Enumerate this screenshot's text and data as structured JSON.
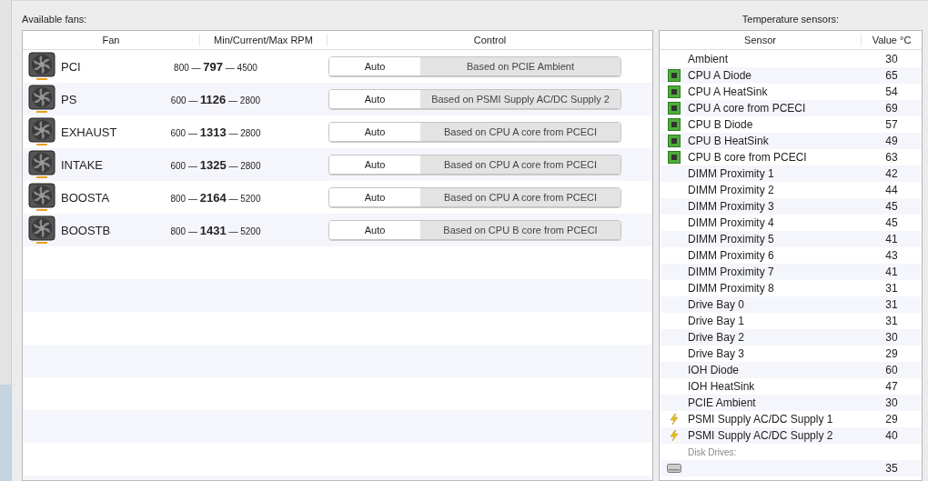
{
  "fans_panel": {
    "title": "Available fans:",
    "columns": [
      "Fan",
      "Min/Current/Max RPM",
      "Control"
    ],
    "rows": [
      {
        "name": "PCI",
        "rpm": "800 — **797** — 4500",
        "mode": "Auto",
        "based_on": "Based on PCIE Ambient"
      },
      {
        "name": "PS",
        "rpm": "600 — **1126** — 2800",
        "mode": "Auto",
        "based_on": "Based on PSMI Supply AC/DC Supply 2"
      },
      {
        "name": "EXHAUST",
        "rpm": "600 — **1313** — 2800",
        "mode": "Auto",
        "based_on": "Based on CPU A core from PCECI"
      },
      {
        "name": "INTAKE",
        "rpm": "600 — **1325** — 2800",
        "mode": "Auto",
        "based_on": "Based on CPU A core from PCECI"
      },
      {
        "name": "BOOSTA",
        "rpm": "800 — **2164** — 5200",
        "mode": "Auto",
        "based_on": "Based on CPU A core from PCECI"
      },
      {
        "name": "BOOSTB",
        "rpm": "800 — **1431** — 5200",
        "mode": "Auto",
        "based_on": "Based on CPU B core from PCECI"
      }
    ]
  },
  "sensors_panel": {
    "title": "Temperature sensors:",
    "columns": [
      "Sensor",
      "Value °C"
    ],
    "rows": [
      {
        "kind": "plain",
        "name": "Ambient",
        "value": "30"
      },
      {
        "kind": "chip",
        "name": "CPU A Diode",
        "value": "65"
      },
      {
        "kind": "chip",
        "name": "CPU A HeatSink",
        "value": "54"
      },
      {
        "kind": "chip",
        "name": "CPU A core from PCECI",
        "value": "69"
      },
      {
        "kind": "chip",
        "name": "CPU B Diode",
        "value": "57"
      },
      {
        "kind": "chip",
        "name": "CPU B HeatSink",
        "value": "49"
      },
      {
        "kind": "chip",
        "name": "CPU B core from PCECI",
        "value": "63"
      },
      {
        "kind": "plain",
        "name": "DIMM Proximity 1",
        "value": "42"
      },
      {
        "kind": "plain",
        "name": "DIMM Proximity 2",
        "value": "44"
      },
      {
        "kind": "plain",
        "name": "DIMM Proximity 3",
        "value": "45"
      },
      {
        "kind": "plain",
        "name": "DIMM Proximity 4",
        "value": "45"
      },
      {
        "kind": "plain",
        "name": "DIMM Proximity 5",
        "value": "41"
      },
      {
        "kind": "plain",
        "name": "DIMM Proximity 6",
        "value": "43"
      },
      {
        "kind": "plain",
        "name": "DIMM Proximity 7",
        "value": "41"
      },
      {
        "kind": "plain",
        "name": "DIMM Proximity 8",
        "value": "31"
      },
      {
        "kind": "plain",
        "name": "Drive Bay 0",
        "value": "31"
      },
      {
        "kind": "plain",
        "name": "Drive Bay 1",
        "value": "31"
      },
      {
        "kind": "plain",
        "name": "Drive Bay 2",
        "value": "30"
      },
      {
        "kind": "plain",
        "name": "Drive Bay 3",
        "value": "29"
      },
      {
        "kind": "plain",
        "name": "IOH Diode",
        "value": "60"
      },
      {
        "kind": "plain",
        "name": "IOH HeatSink",
        "value": "47"
      },
      {
        "kind": "plain",
        "name": "PCIE Ambient",
        "value": "30"
      },
      {
        "kind": "power",
        "name": "PSMI Supply AC/DC Supply 1",
        "value": "29"
      },
      {
        "kind": "power",
        "name": "PSMI Supply AC/DC Supply 2",
        "value": "40"
      },
      {
        "kind": "group",
        "name": "Disk Drives:"
      },
      {
        "kind": "drive",
        "value": "35"
      }
    ]
  }
}
